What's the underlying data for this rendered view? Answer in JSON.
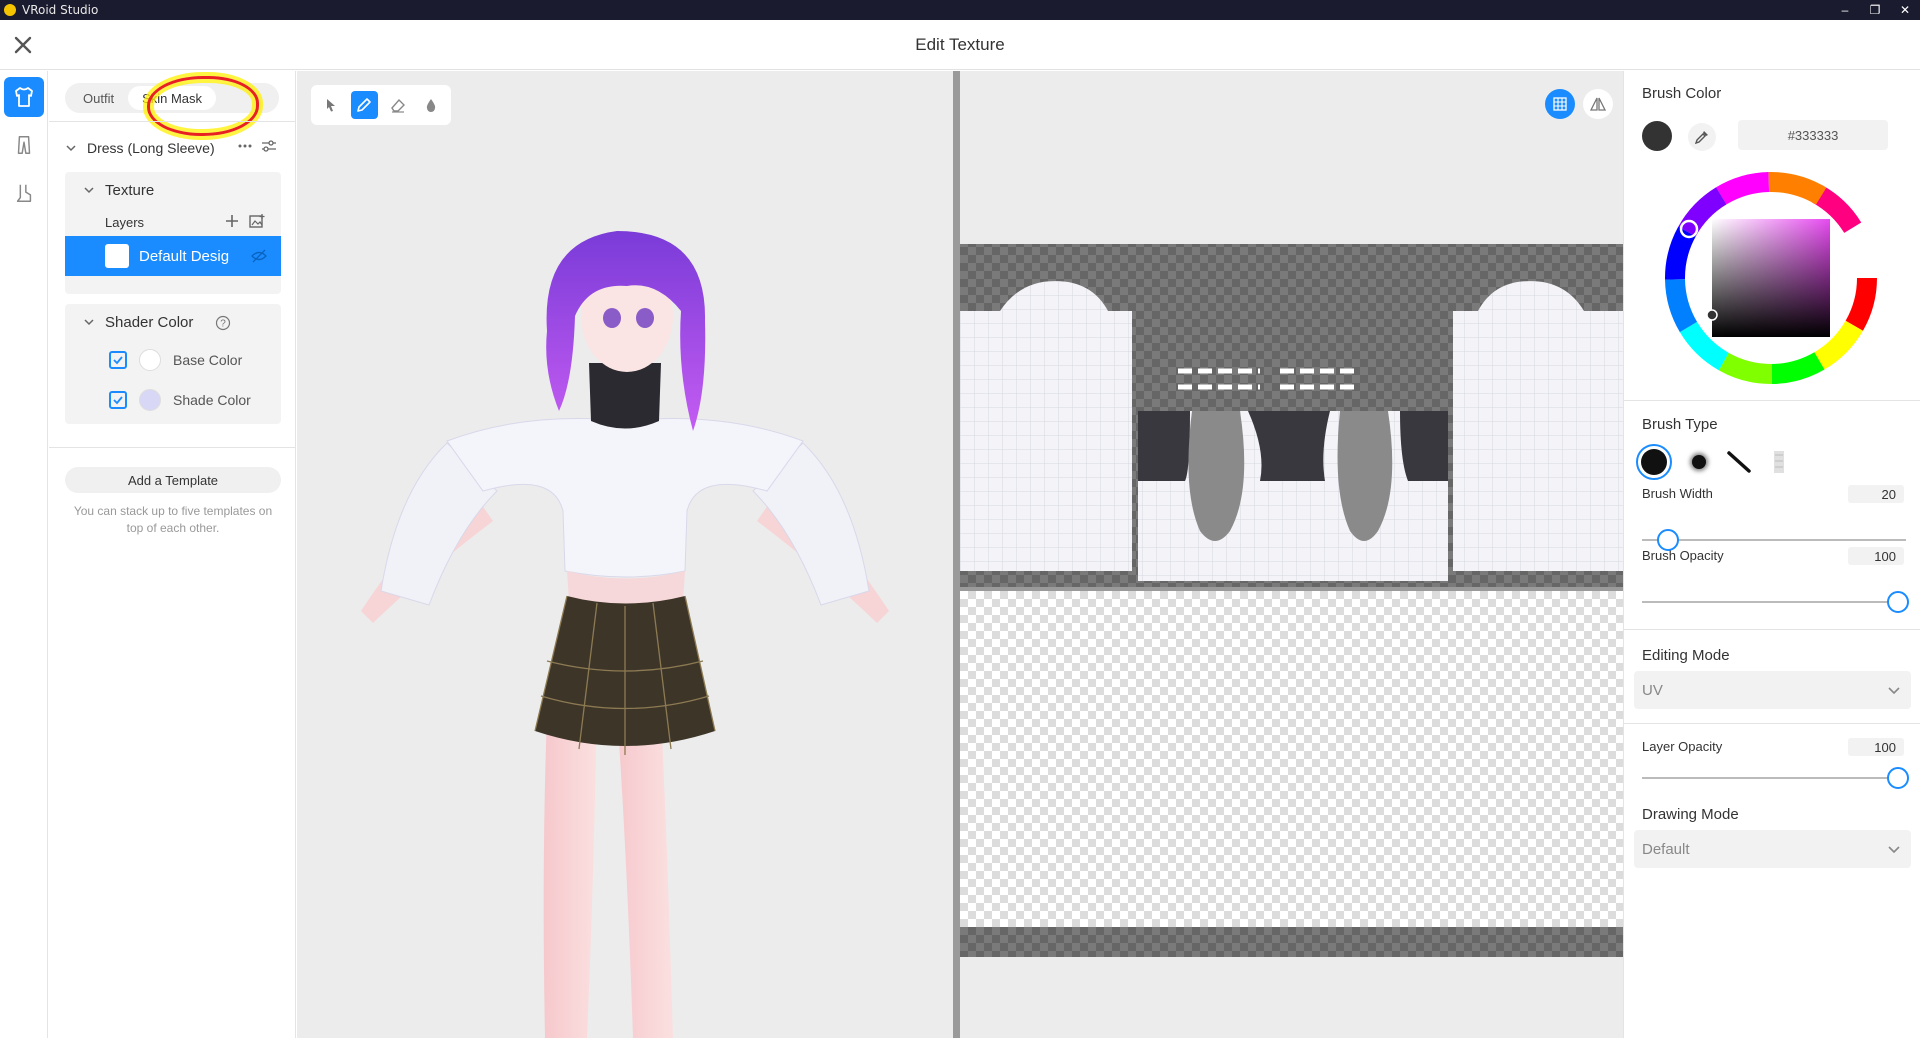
{
  "window": {
    "app_title": "VRoid Studio",
    "controls": [
      "–",
      "❐",
      "✕"
    ]
  },
  "header": {
    "title": "Edit Texture"
  },
  "left_panel": {
    "tabs": [
      {
        "label": "Outfit"
      },
      {
        "label": "Skin Mask"
      }
    ],
    "item_title": "Dress (Long Sleeve)",
    "texture": {
      "title": "Texture",
      "layers_label": "Layers",
      "layer_name": "Default Desig"
    },
    "shader": {
      "title": "Shader Color",
      "base_label": "Base Color",
      "shade_label": "Shade Color"
    },
    "template": {
      "button": "Add a Template",
      "note": "You can stack up to five templates on top of each other."
    }
  },
  "right_panel": {
    "brush_color": {
      "title": "Brush Color",
      "hex": "#333333"
    },
    "brush_type": {
      "title": "Brush Type"
    },
    "brush_width": {
      "label": "Brush Width",
      "value": "20"
    },
    "brush_opacity": {
      "label": "Brush Opacity",
      "value": "100"
    },
    "editing_mode": {
      "title": "Editing Mode",
      "value": "UV"
    },
    "layer_opacity": {
      "label": "Layer Opacity",
      "value": "100"
    },
    "drawing_mode": {
      "title": "Drawing Mode",
      "value": "Default"
    }
  },
  "colors": {
    "accent": "#1a8cff",
    "brush": "#333333",
    "base_swatch": "#ffffff",
    "shade_swatch": "#d8d8f6"
  }
}
